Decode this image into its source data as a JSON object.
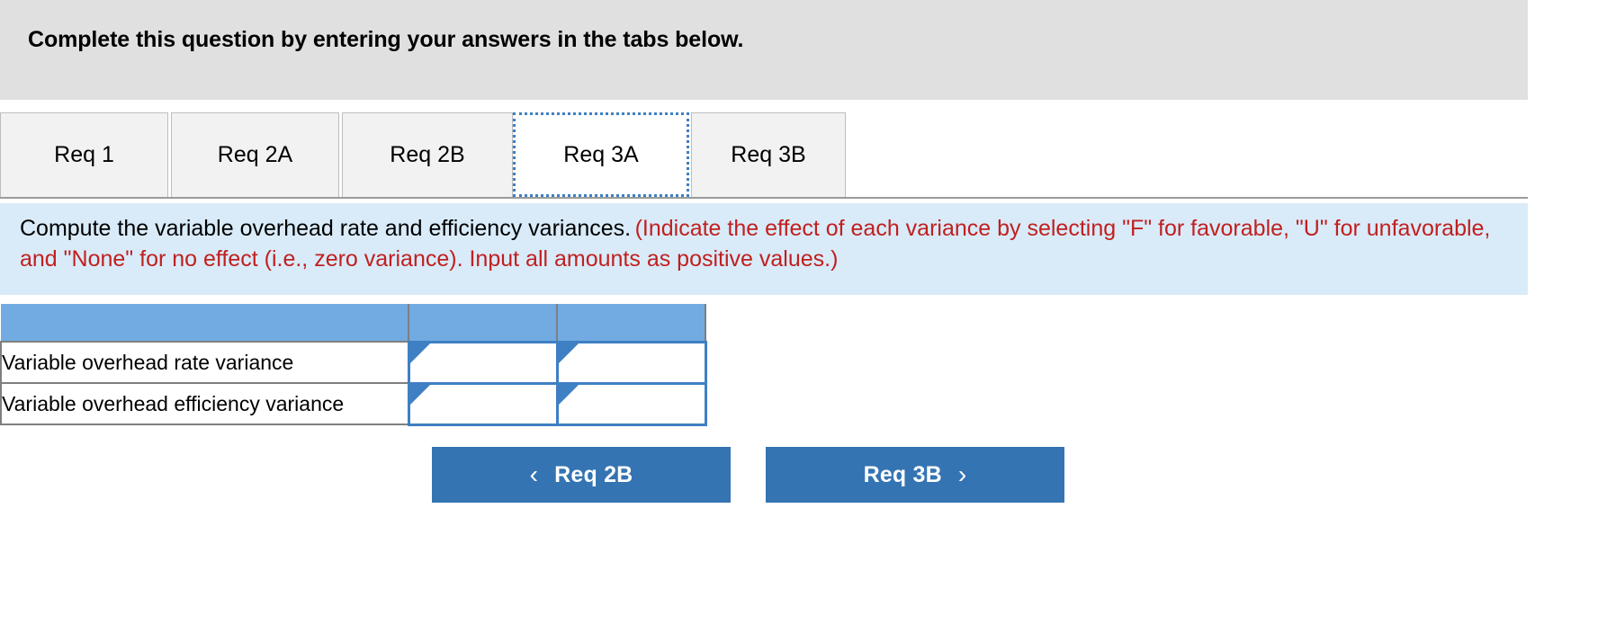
{
  "banner": {
    "text": "Complete this question by entering your answers in the tabs below."
  },
  "tabs": {
    "items": [
      {
        "label": "Req 1",
        "active": false
      },
      {
        "label": "Req 2A",
        "active": false
      },
      {
        "label": "Req 2B",
        "active": false
      },
      {
        "label": "Req 3A",
        "active": true
      },
      {
        "label": "Req 3B",
        "active": false
      }
    ]
  },
  "requirement": {
    "main": "Compute the variable overhead rate and efficiency variances.",
    "note": "(Indicate the effect of each variance by selecting \"F\" for favorable, \"U\" for unfavorable, and \"None\" for no effect (i.e., zero variance). Input all amounts as positive values.)"
  },
  "table": {
    "headers": [
      "",
      "",
      ""
    ],
    "rows": [
      {
        "label": "Variable overhead rate variance",
        "amount": "",
        "effect": ""
      },
      {
        "label": "Variable overhead efficiency variance",
        "amount": "",
        "effect": ""
      }
    ]
  },
  "nav": {
    "prev_label": "Req 2B",
    "prev_icon": "chevron-left-icon",
    "prev_chevron": "‹",
    "next_label": "Req 3B",
    "next_icon": "chevron-right-icon",
    "next_chevron": "›"
  },
  "colors": {
    "banner_bg": "#e0e0e0",
    "req_band_bg": "#d9ebf9",
    "note_red": "#c0201f",
    "table_header_blue": "#72abe2",
    "input_border_blue": "#3f7fc4",
    "button_blue": "#3574b2"
  }
}
